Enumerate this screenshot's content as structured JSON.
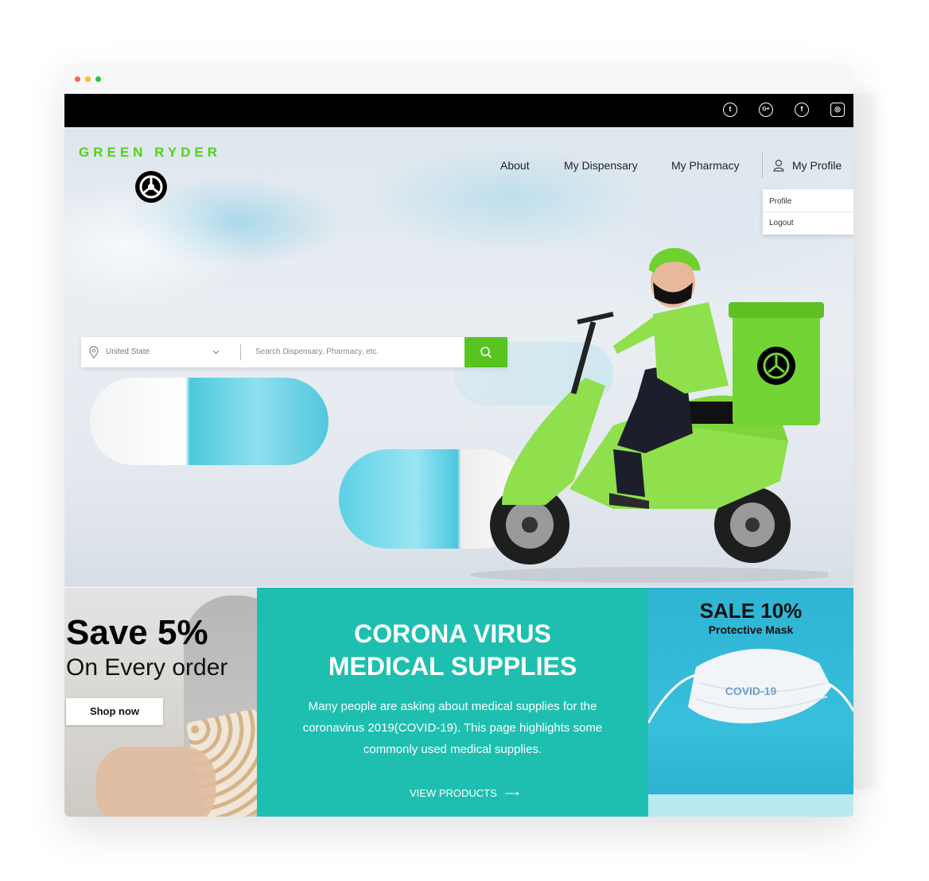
{
  "browser": {
    "window_dots": [
      "close",
      "minimize",
      "maximize"
    ]
  },
  "social": {
    "icons": [
      "twitter-icon",
      "google-plus-icon",
      "facebook-icon",
      "instagram-icon"
    ]
  },
  "brand": {
    "name": "GREEN RYDER",
    "color": "#52d11c"
  },
  "nav": {
    "about": "About",
    "dispensary": "My Dispensary",
    "pharmacy": "My Pharmacy",
    "profile": "My Profile",
    "dropdown": [
      "Profile",
      "Logout"
    ]
  },
  "search": {
    "location": "United State",
    "placeholder": "Search Dispensary, Pharmacy, etc.",
    "button_color": "#57c41f"
  },
  "promo_left": {
    "headline": "Save 5%",
    "subline": "On Every order",
    "button": "Shop now"
  },
  "promo_center": {
    "title_line1": "CORONA VIRUS",
    "title_line2": "MEDICAL SUPPLIES",
    "body": "Many people are asking about medical supplies for the coronavirus 2019(COVID-19). This page highlights some commonly used medical supplies.",
    "cta": "VIEW PRODUCTS",
    "bg_color": "#1ebfb0"
  },
  "promo_right": {
    "headline": "SALE 10%",
    "subline": "Protective Mask",
    "mask_text": "COVID-19"
  }
}
